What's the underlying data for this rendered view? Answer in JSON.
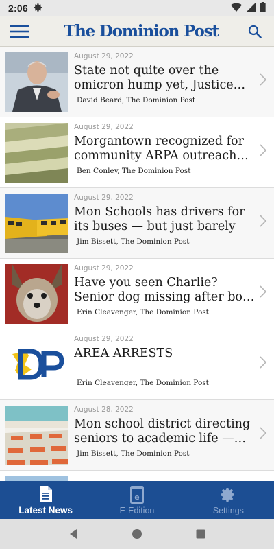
{
  "status_bar": {
    "time": "2:06"
  },
  "header": {
    "logo": "The Dominion Post"
  },
  "articles": [
    {
      "date": "August 29, 2022",
      "title": "State not quite over the omicron hump yet, Justice an…",
      "byline": "David Beard, The Dominion Post",
      "image": "man-speaking-photo"
    },
    {
      "date": "August 29, 2022",
      "title": "Morgantown recognized for community ARPA outreach eff…",
      "byline": "Ben Conley, The Dominion Post",
      "image": "money-stack-photo"
    },
    {
      "date": "August 29, 2022",
      "title": "Mon Schools has drivers for its buses — but just barely",
      "byline": "Jim Bissett, The Dominion Post",
      "image": "school-buses-photo"
    },
    {
      "date": "August 29, 2022",
      "title": "Have you seen Charlie? Senior dog missing after boat ride",
      "byline": "Erin Cleavenger, The Dominion Post",
      "image": "dog-photo"
    },
    {
      "date": "August 29, 2022",
      "title": "AREA ARRESTS",
      "byline": "Erin Cleavenger, The Dominion Post",
      "image": "dp-logo"
    },
    {
      "date": "August 28, 2022",
      "title": "Mon school district directing seniors to academic life — aft…",
      "byline": "Jim Bissett, The Dominion Post",
      "image": "classroom-photo"
    }
  ],
  "bottom_nav": [
    {
      "label": "Latest News",
      "icon": "document-icon",
      "active": true
    },
    {
      "label": "E-Edition",
      "icon": "e-edition-icon",
      "active": false
    },
    {
      "label": "Settings",
      "icon": "gear-icon",
      "active": false
    }
  ],
  "colors": {
    "brand_blue": "#1c4e93",
    "logo_blue": "#1a4f9c",
    "dp_yellow": "#f2c318"
  }
}
